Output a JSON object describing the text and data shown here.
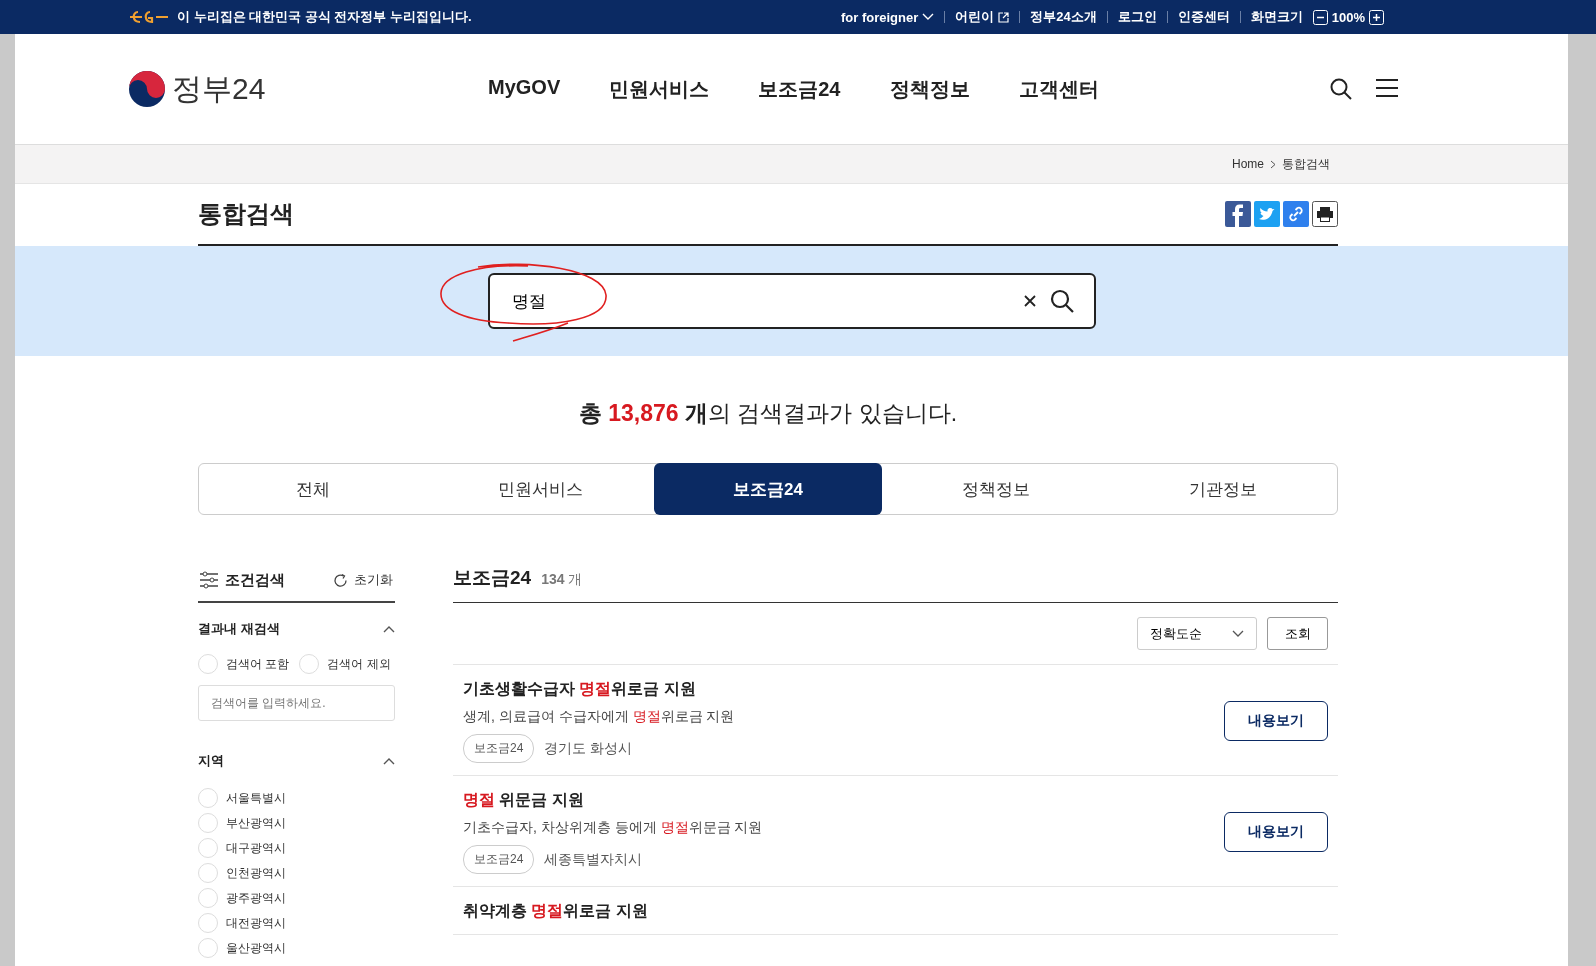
{
  "top_bar": {
    "notice": "이 누리집은 대한민국 공식 전자정부 누리집입니다.",
    "links": [
      {
        "label": "for foreigner",
        "kind": "dropdown"
      },
      {
        "label": "어린이",
        "kind": "external"
      },
      {
        "label": "정부24소개",
        "kind": "plain"
      },
      {
        "label": "로그인",
        "kind": "plain"
      },
      {
        "label": "인증센터",
        "kind": "plain"
      }
    ],
    "zoom": {
      "label": "화면크기",
      "value": "100%"
    }
  },
  "header": {
    "logo_text": "정부24",
    "nav": [
      "MyGOV",
      "민원서비스",
      "보조금24",
      "정책정보",
      "고객센터"
    ]
  },
  "breadcrumb": [
    "Home",
    "통합검색"
  ],
  "page_title": "통합검색",
  "search": {
    "value": "명절"
  },
  "summary": {
    "prefix": "총",
    "count": "13,876",
    "unit": "개",
    "suffix": "의 검색결과가 있습니다."
  },
  "tabs": [
    {
      "label": "전체",
      "selected": false
    },
    {
      "label": "민원서비스",
      "selected": false
    },
    {
      "label": "보조금24",
      "selected": true
    },
    {
      "label": "정책정보",
      "selected": false
    },
    {
      "label": "기관정보",
      "selected": false
    }
  ],
  "filter": {
    "title": "조건검색",
    "reset": "초기화",
    "sections": [
      {
        "title": "결과내 재검색",
        "expanded": true,
        "inline": true,
        "options": [
          {
            "label": "검색어 포함",
            "checked": false
          },
          {
            "label": "검색어 제외",
            "checked": false
          }
        ],
        "placeholder": "검색어를 입력하세요."
      },
      {
        "title": "지역",
        "expanded": true,
        "inline": false,
        "options": [
          {
            "label": "서울특별시",
            "checked": false
          },
          {
            "label": "부산광역시",
            "checked": false
          },
          {
            "label": "대구광역시",
            "checked": false
          },
          {
            "label": "인천광역시",
            "checked": false
          },
          {
            "label": "광주광역시",
            "checked": false
          },
          {
            "label": "대전광역시",
            "checked": false
          },
          {
            "label": "울산광역시",
            "checked": false
          }
        ]
      }
    ]
  },
  "results": {
    "title": "보조금24",
    "count": "134",
    "unit": "개",
    "sort": "정확도순",
    "query_button": "조회",
    "items": [
      {
        "title": [
          {
            "text": "기초생활수급자 ",
            "highlight": false
          },
          {
            "text": "명절",
            "highlight": true
          },
          {
            "text": "위로금 지원",
            "highlight": false
          }
        ],
        "desc": [
          {
            "text": "생계, 의료급여 수급자에게 ",
            "highlight": false
          },
          {
            "text": "명절",
            "highlight": true
          },
          {
            "text": "위로금 지원",
            "highlight": false
          }
        ],
        "tag": "보조금24",
        "region": "경기도 화성시",
        "button": "내용보기"
      },
      {
        "title": [
          {
            "text": "명절",
            "highlight": true
          },
          {
            "text": " 위문금 지원",
            "highlight": false
          }
        ],
        "desc": [
          {
            "text": "기초수급자, 차상위계층 등에게 ",
            "highlight": false
          },
          {
            "text": "명절",
            "highlight": true
          },
          {
            "text": "위문금 지원",
            "highlight": false
          }
        ],
        "tag": "보조금24",
        "region": "세종특별자치시",
        "button": "내용보기"
      },
      {
        "title": [
          {
            "text": "취약계층 ",
            "highlight": false
          },
          {
            "text": "명절",
            "highlight": true
          },
          {
            "text": "위로금 지원",
            "highlight": false
          }
        ]
      }
    ]
  }
}
